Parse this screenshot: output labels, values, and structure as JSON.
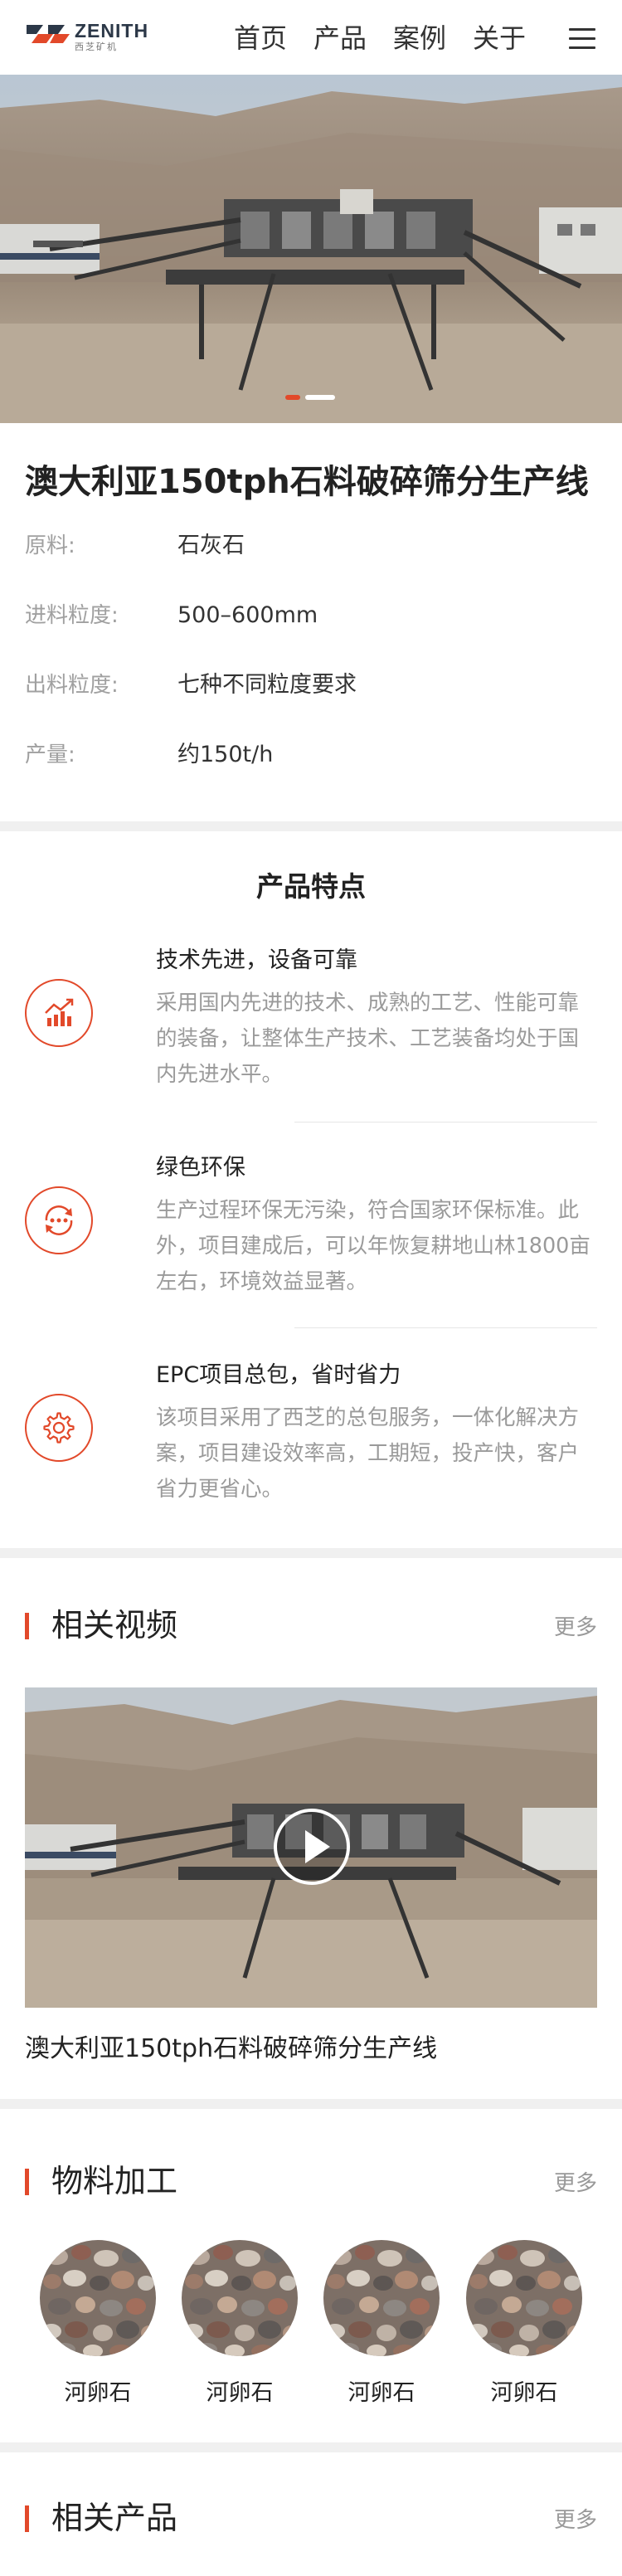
{
  "header": {
    "logo_text": "ZENITH",
    "logo_sub": "西芝矿机",
    "nav": [
      "首页",
      "产品",
      "案例",
      "关于"
    ]
  },
  "hero": {
    "slide_count": 2,
    "active_slide": 1
  },
  "product": {
    "title": "澳大利亚150tph石料破碎筛分生产线",
    "specs": [
      {
        "label": "原料:",
        "value": "石灰石"
      },
      {
        "label": "进料粒度:",
        "value": "500–600mm"
      },
      {
        "label": "出料粒度:",
        "value": "七种不同粒度要求"
      },
      {
        "label": "产量:",
        "value": "约150t/h"
      }
    ]
  },
  "features": {
    "title": "产品特点",
    "items": [
      {
        "icon": "chart-growth-icon",
        "title": "技术先进，设备可靠",
        "desc": "采用国内先进的技术、成熟的工艺、性能可靠的装备，让整体生产技术、工艺装备均处于国内先进水平。"
      },
      {
        "icon": "recycle-eco-icon",
        "title": "绿色环保",
        "desc": "生产过程环保无污染，符合国家环保标准。此外，项目建成后，可以年恢复耕地山林1800亩左右，环境效益显著。"
      },
      {
        "icon": "gear-icon",
        "title": "EPC项目总包，省时省力",
        "desc": "该项目采用了西芝的总包服务，一体化解决方案，项目建设效率高，工期短，投产快，客户省力更省心。"
      }
    ]
  },
  "video_section": {
    "title": "相关视频",
    "more": "更多",
    "caption": "澳大利亚150tph石料破碎筛分生产线"
  },
  "materials_section": {
    "title": "物料加工",
    "more": "更多",
    "items": [
      {
        "label": "河卵石"
      },
      {
        "label": "河卵石"
      },
      {
        "label": "河卵石"
      },
      {
        "label": "河卵石"
      }
    ]
  },
  "products_section": {
    "title": "相关产品",
    "more": "更多"
  },
  "colors": {
    "accent": "#e2492a",
    "divider": "#f0f0f0",
    "muted": "#9a9a9a"
  }
}
